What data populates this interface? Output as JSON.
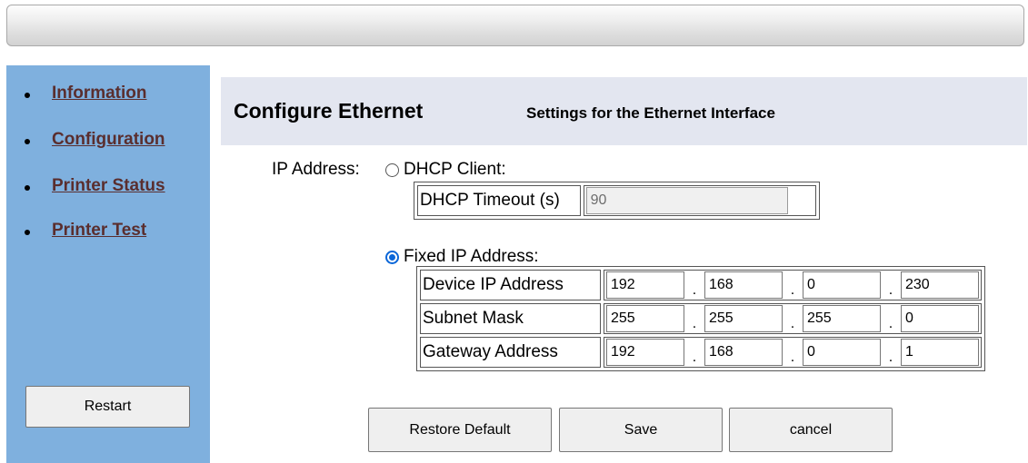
{
  "sidebar": {
    "items": [
      {
        "label": "Information"
      },
      {
        "label": "Configuration"
      },
      {
        "label": "Printer Status"
      },
      {
        "label": "Printer Test"
      }
    ],
    "restart_label": "Restart"
  },
  "header": {
    "title": "Configure Ethernet",
    "subtitle": "Settings for the Ethernet Interface"
  },
  "form": {
    "ip_label": "IP Address:",
    "dhcp": {
      "label": "DHCP Client:",
      "selected": false,
      "timeout_label": "DHCP Timeout (s)",
      "timeout_value": "90"
    },
    "fixed": {
      "label": "Fixed IP Address:",
      "selected": true,
      "rows": [
        {
          "label": "Device IP Address",
          "octets": [
            "192",
            "168",
            "0",
            "230"
          ]
        },
        {
          "label": "Subnet Mask",
          "octets": [
            "255",
            "255",
            "255",
            "0"
          ]
        },
        {
          "label": "Gateway Address",
          "octets": [
            "192",
            "168",
            "0",
            "1"
          ]
        }
      ],
      "separator": "."
    }
  },
  "buttons": {
    "restore_default": "Restore Default",
    "save": "Save",
    "cancel": "cancel"
  },
  "colors": {
    "sidebar_bg": "#7fb0de",
    "header_band_bg": "#e3e6f0",
    "link_color": "#5a2e2e",
    "radio_accent": "#0a66d8"
  }
}
